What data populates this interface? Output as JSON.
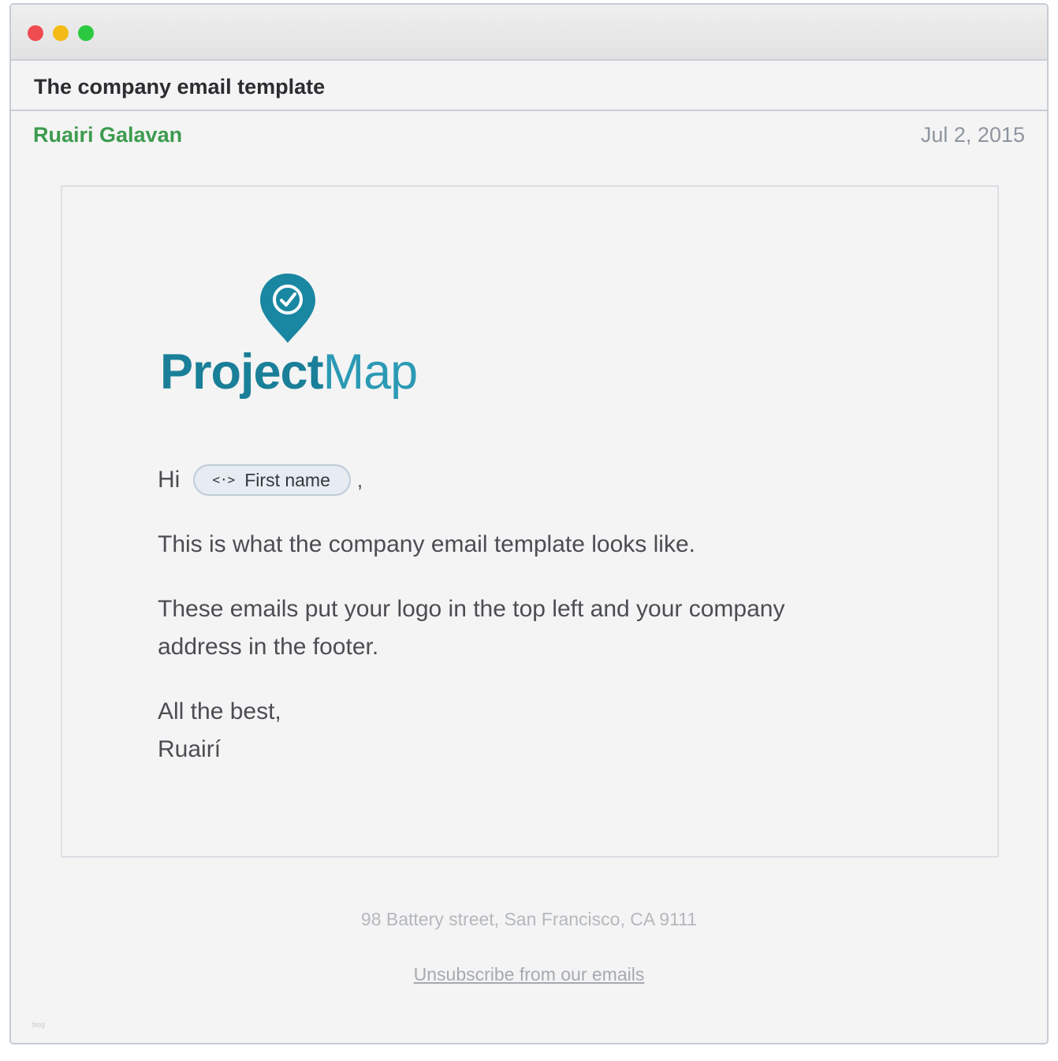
{
  "email": {
    "subject": "The company email template",
    "sender": "Ruairi Galavan",
    "date": "Jul 2, 2015"
  },
  "logo": {
    "word_bold": "Project",
    "word_light": "Map",
    "color": "#1a7f98"
  },
  "body": {
    "greeting": "Hi",
    "merge_tag": "First name",
    "merge_tag_icon": "code-arrows-icon",
    "comma": ",",
    "paragraph1": "This is what the company email template looks like.",
    "paragraph2": "These emails put your logo in the top left and your company address in the footer.",
    "signoff_line1": "All the best,",
    "signoff_line2": "Ruairí"
  },
  "footer": {
    "address": "98 Battery street, San Francisco, CA 9111",
    "unsubscribe": "Unsubscribe from our emails",
    "watermark": "blog"
  },
  "colors": {
    "sender": "#3d9b4e",
    "close": "#ef4c50",
    "minimize": "#f4bb16",
    "maximize": "#2bc93f"
  }
}
